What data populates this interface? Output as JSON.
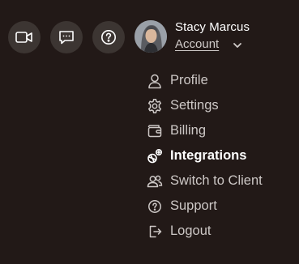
{
  "toolbar": {
    "buttons": [
      {
        "icon": "video-camera-icon"
      },
      {
        "icon": "chat-icon"
      },
      {
        "icon": "help-icon"
      }
    ]
  },
  "user": {
    "name": "Stacy Marcus",
    "account_label": "Account",
    "avatar": "avatar-photo"
  },
  "menu": {
    "items": [
      {
        "label": "Profile",
        "icon": "user-icon"
      },
      {
        "label": "Settings",
        "icon": "gear-icon"
      },
      {
        "label": "Billing",
        "icon": "wallet-icon"
      },
      {
        "label": "Integrations",
        "icon": "integrations-icon",
        "active": true
      },
      {
        "label": "Switch to Client",
        "icon": "users-icon"
      },
      {
        "label": "Support",
        "icon": "help-circle-icon"
      },
      {
        "label": "Logout",
        "icon": "logout-icon"
      }
    ]
  },
  "colors": {
    "background": "#221917",
    "button_bg": "#3c3532",
    "text_primary": "#ffffff",
    "text_secondary": "#cdc8c6"
  }
}
